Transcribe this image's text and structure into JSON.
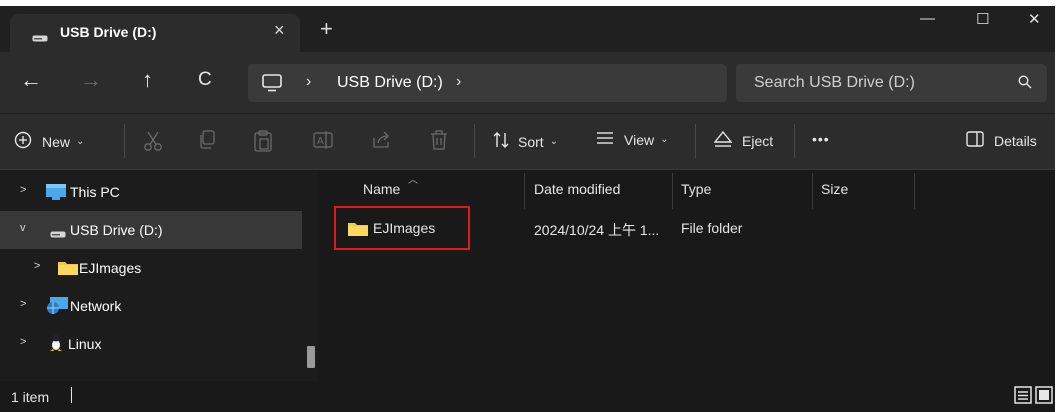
{
  "tab": {
    "title": "USB Drive (D:)",
    "close": "×",
    "new_tab": "+"
  },
  "window_controls": {
    "minimize": "—",
    "maximize": "☐",
    "close": "✕"
  },
  "nav": {
    "back": "←",
    "forward": "→",
    "up": "↑",
    "refresh": "C"
  },
  "address": {
    "sep1": "›",
    "crumb": "USB Drive (D:)",
    "sep2": "›"
  },
  "search": {
    "placeholder": "Search USB Drive (D:)"
  },
  "toolbar": {
    "new_label": "New",
    "sort_label": "Sort",
    "view_label": "View",
    "eject_label": "Eject",
    "more": "•••",
    "details_label": "Details"
  },
  "sidebar": {
    "items": [
      {
        "label": "This PC",
        "arrow": ">",
        "icon": "monitor-icon"
      },
      {
        "label": "USB Drive (D:)",
        "arrow": "v",
        "icon": "drive-icon",
        "selected": true
      },
      {
        "label": "EJImages",
        "arrow": ">",
        "icon": "folder-icon"
      },
      {
        "label": "Network",
        "arrow": ">",
        "icon": "network-icon"
      },
      {
        "label": "Linux",
        "arrow": ">",
        "icon": "penguin-icon"
      }
    ]
  },
  "columns": {
    "name": "Name",
    "date": "Date modified",
    "type": "Type",
    "size": "Size"
  },
  "rows": [
    {
      "name": "EJImages",
      "date": "2024/10/24 上午 1...",
      "type": "File folder",
      "size": ""
    }
  ],
  "status": {
    "count": "1 item"
  },
  "colors": {
    "accent": "#f7c948",
    "highlight": "#e11b1b",
    "background": "#191919"
  }
}
